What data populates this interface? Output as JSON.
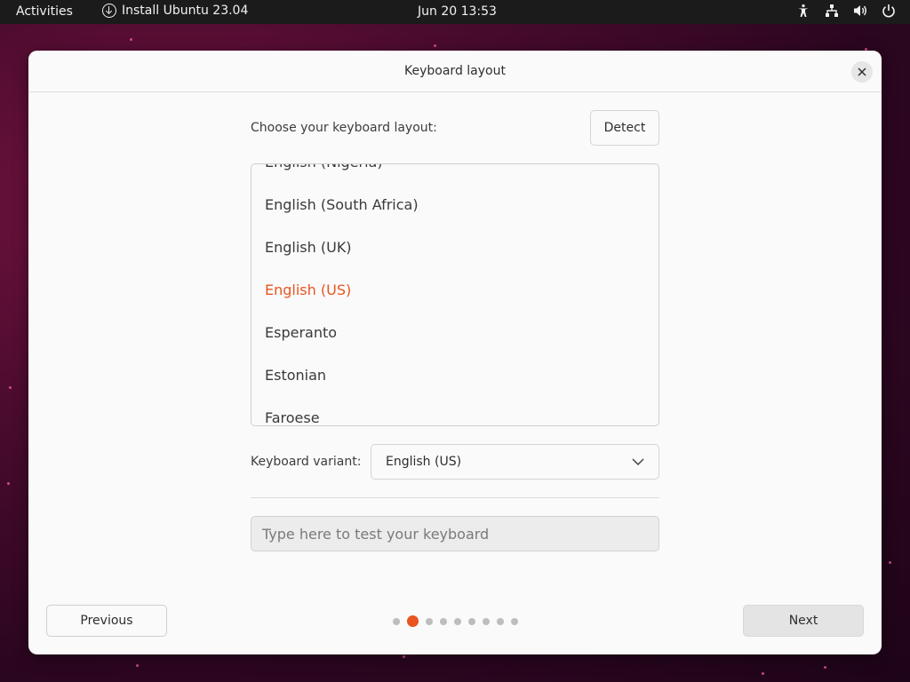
{
  "topbar": {
    "activities": "Activities",
    "app_name": "Install Ubuntu 23.04",
    "clock": "Jun 20  13:53"
  },
  "window": {
    "title": "Keyboard layout",
    "choose_label": "Choose your keyboard layout:",
    "detect_label": "Detect",
    "layouts": [
      {
        "label": "English (Nigeria)",
        "selected": false
      },
      {
        "label": "English (South Africa)",
        "selected": false
      },
      {
        "label": "English (UK)",
        "selected": false
      },
      {
        "label": "English (US)",
        "selected": true
      },
      {
        "label": "Esperanto",
        "selected": false
      },
      {
        "label": "Estonian",
        "selected": false
      },
      {
        "label": "Faroese",
        "selected": false
      }
    ],
    "variant_label": "Keyboard variant:",
    "variant_value": "English (US)",
    "test_placeholder": "Type here to test your keyboard",
    "test_value": "",
    "previous_label": "Previous",
    "next_label": "Next",
    "steps_total": 9,
    "steps_current": 2
  },
  "colors": {
    "accent": "#e95420",
    "topbar": "#1b1b1b"
  }
}
